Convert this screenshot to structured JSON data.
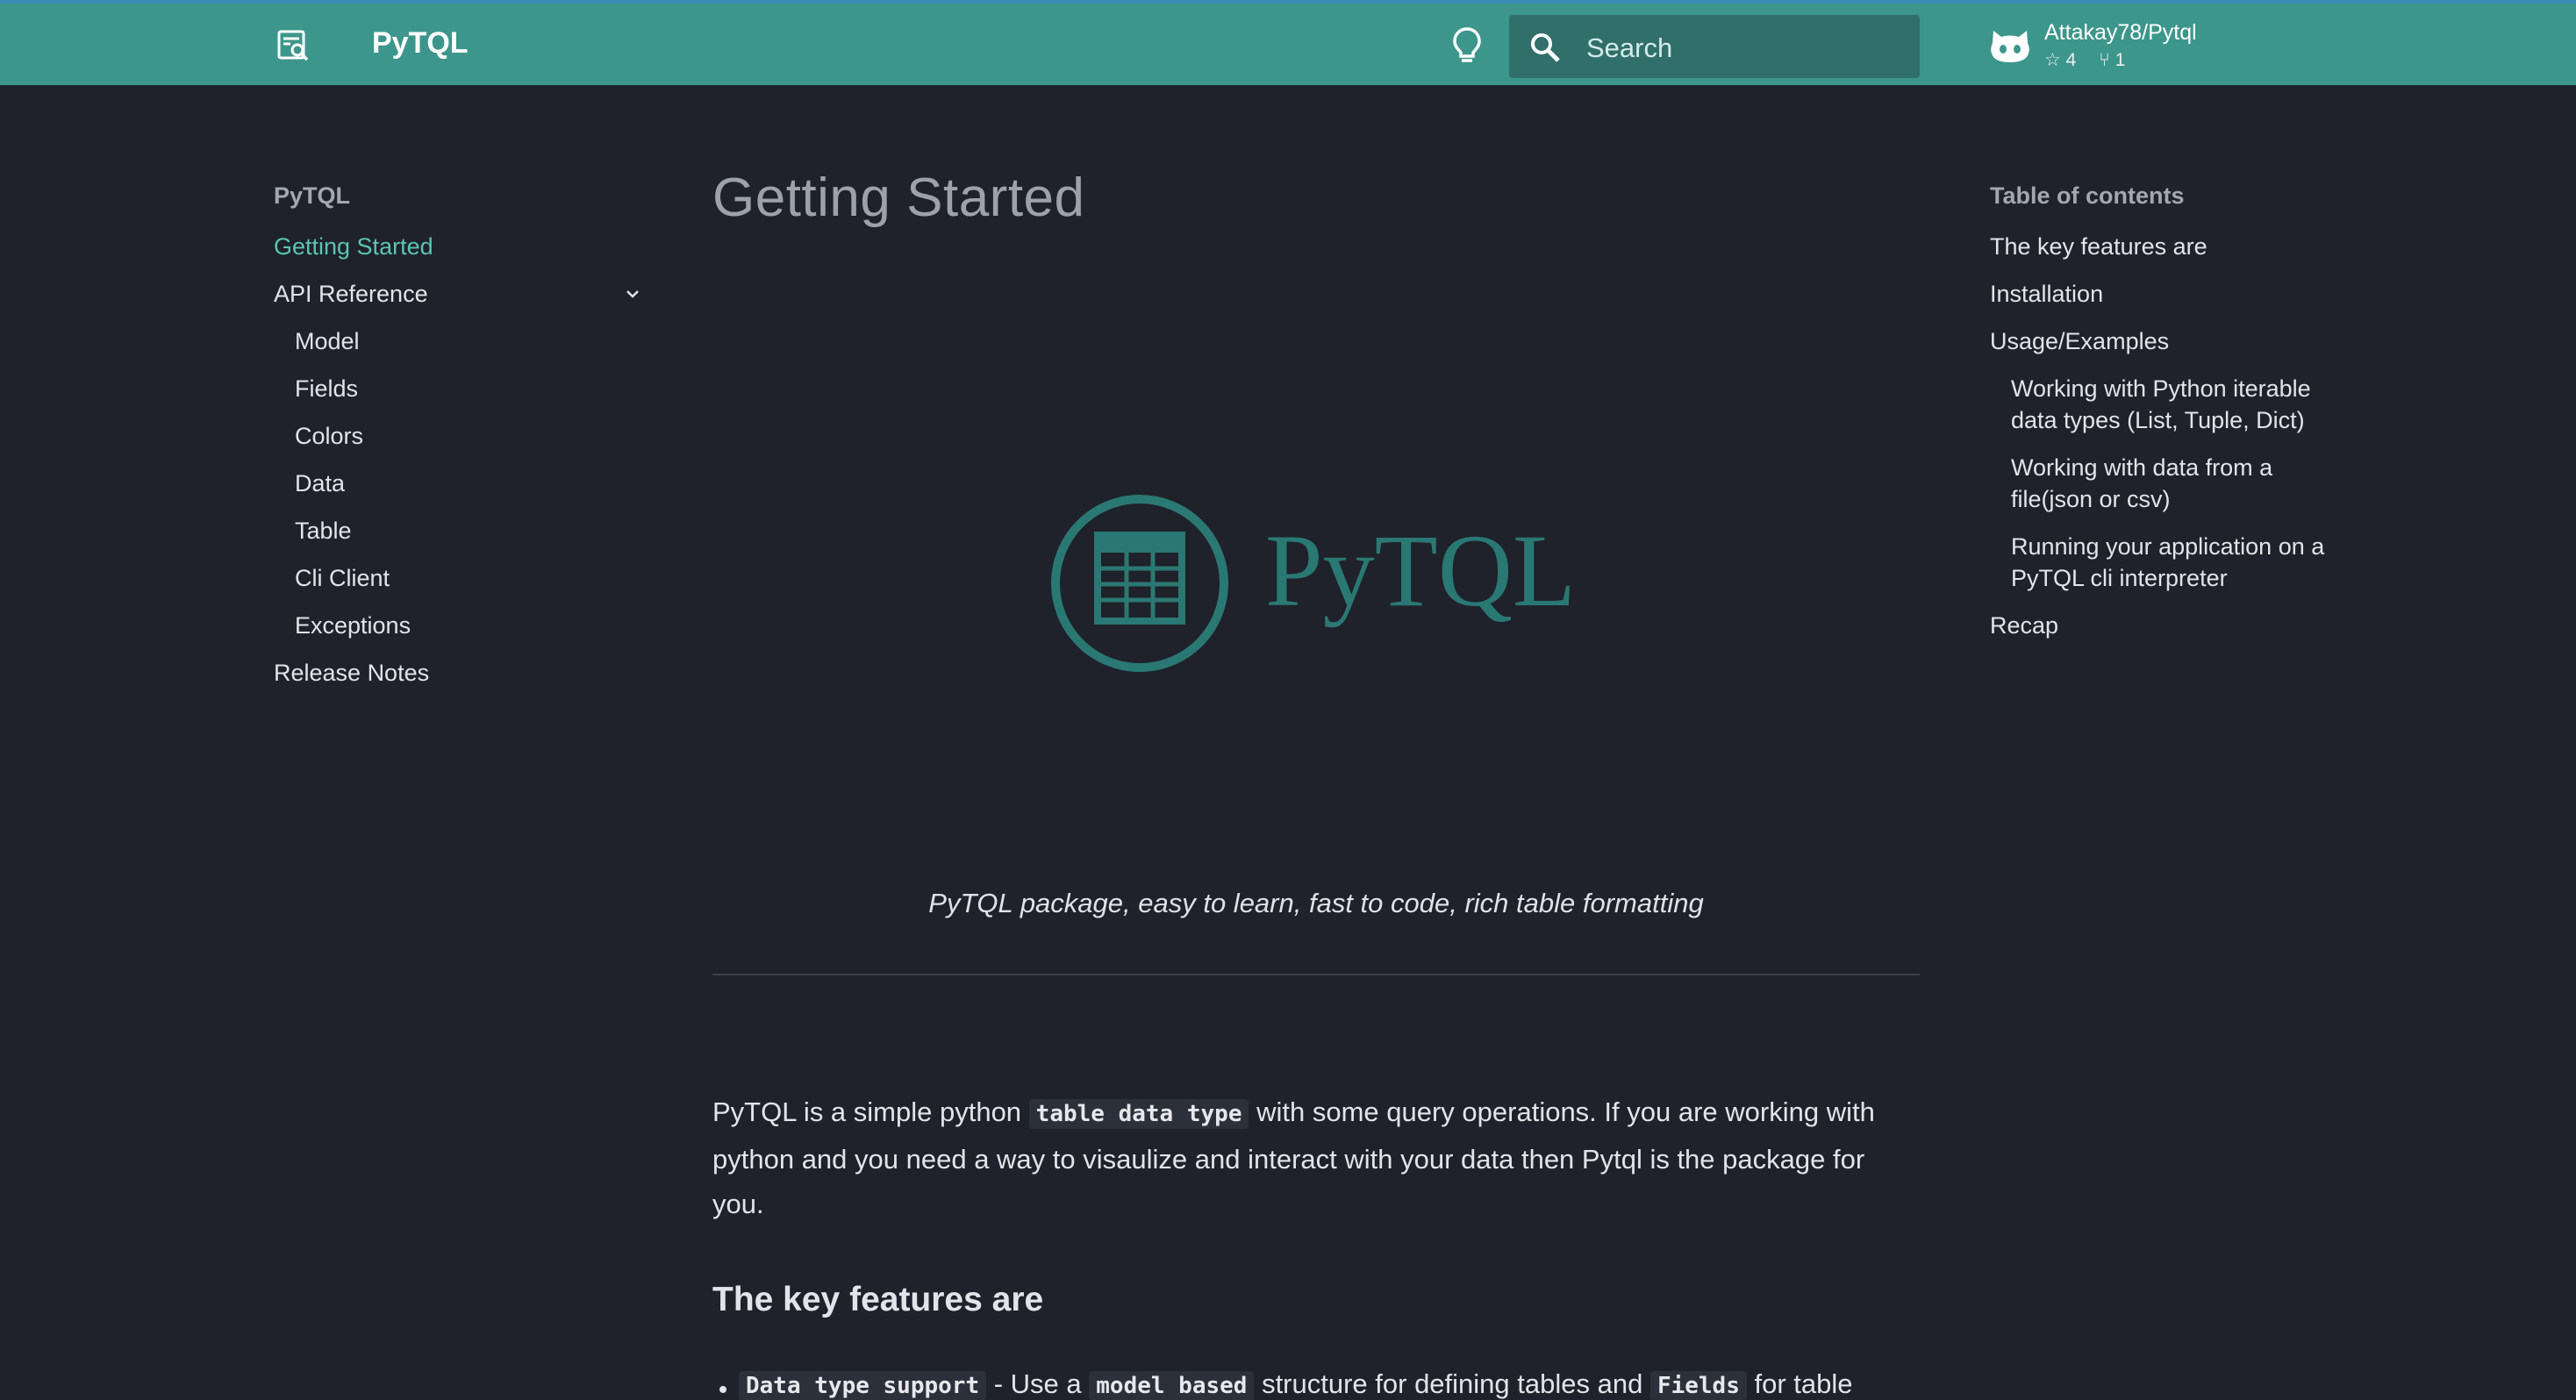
{
  "header": {
    "title": "PyTQL",
    "search_placeholder": "Search",
    "repo": {
      "name": "Attakay78/Pytql",
      "stars": "4",
      "forks": "1"
    }
  },
  "nav": {
    "title": "PyTQL",
    "items": [
      {
        "label": "Getting Started"
      },
      {
        "label": "API Reference"
      },
      {
        "label": "Model"
      },
      {
        "label": "Fields"
      },
      {
        "label": "Colors"
      },
      {
        "label": "Data"
      },
      {
        "label": "Table"
      },
      {
        "label": "Cli Client"
      },
      {
        "label": "Exceptions"
      },
      {
        "label": "Release Notes"
      }
    ]
  },
  "main": {
    "title": "Getting Started",
    "logo_text": "PyTQL",
    "tagline": "PyTQL package, easy to learn, fast to code, rich table formatting",
    "intro_before": "PyTQL is a simple python ",
    "intro_code": "table data type",
    "intro_after": " with some query operations. If you are working with python and you need a way to visaulize and interact with your data then Pytql is the package for you.",
    "features_heading": "The key features are",
    "feature_code1": "Data type support",
    "feature_text1": " - Use a ",
    "feature_code2": "model based",
    "feature_text2": " structure for defining tables and ",
    "feature_code3": "Fields",
    "feature_text3": " for table"
  },
  "toc": {
    "title": "Table of contents",
    "items": [
      {
        "label": "The key features are"
      },
      {
        "label": "Installation"
      },
      {
        "label": "Usage/Examples"
      },
      {
        "label": "Working with Python iterable data types (List, Tuple, Dict)"
      },
      {
        "label": "Working with data from a file(json or csv)"
      },
      {
        "label": "Running your application on a PyTQL cli interpreter"
      },
      {
        "label": "Recap"
      }
    ]
  },
  "colors": {
    "header_bg": "#3d968c",
    "page_bg": "#1f222a",
    "accent": "#5bc4b4",
    "logo": "#2a7873"
  },
  "icons": {
    "brand": "document-search-icon",
    "theme": "lightbulb-icon",
    "search": "search-icon",
    "repo": "github-icon",
    "star": "star-icon",
    "fork": "fork-icon",
    "chevron": "chevron-down-icon"
  }
}
